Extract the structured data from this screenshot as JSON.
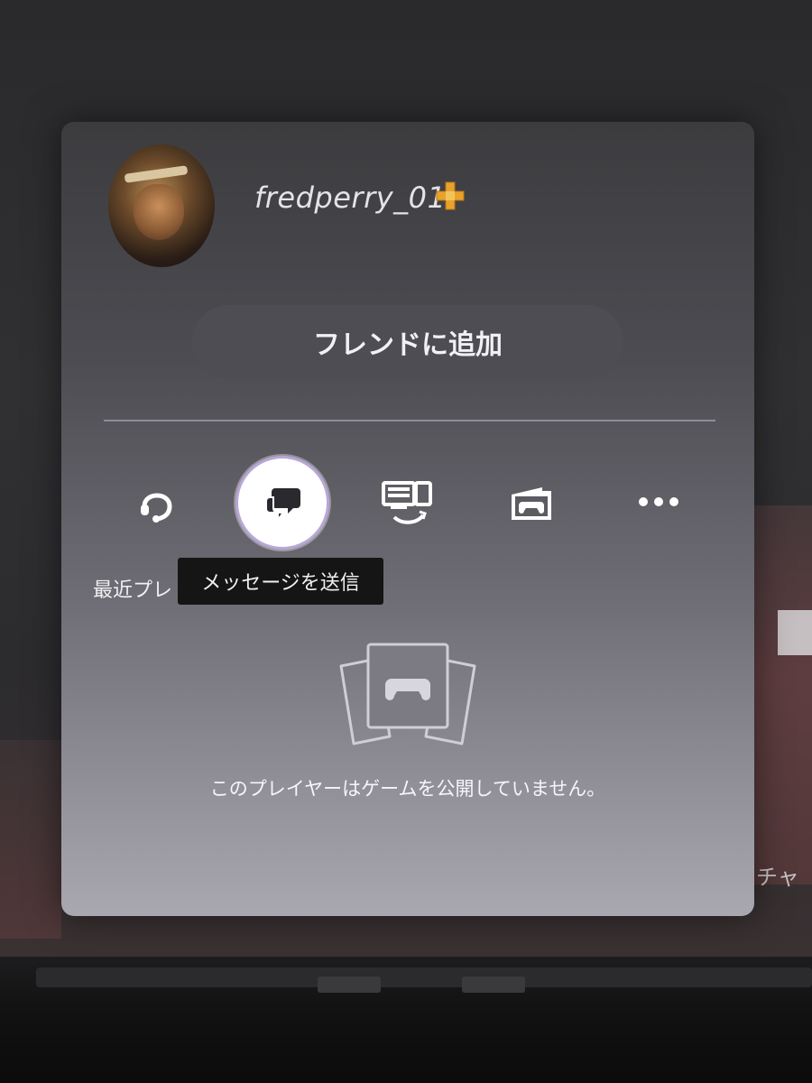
{
  "profile": {
    "username": "fredperry_01",
    "plus_badge_icon": "playstation-plus-icon",
    "plus_color": "#e8a22b"
  },
  "actions": {
    "add_friend_label": "フレンドに追加",
    "icons": [
      "headset-icon",
      "message-icon",
      "share-screen-icon",
      "game-card-icon",
      "more-icon"
    ]
  },
  "tooltip": {
    "text": "メッセージを送信"
  },
  "recent_label": "最近プレ",
  "games": {
    "empty_text": "このプレイヤーはゲームを公開していません。",
    "empty_icon": "game-library-icon"
  },
  "background": {
    "partial_text": "チャ"
  },
  "colors": {
    "accent_ring": "#b9a6d8",
    "tooltip_bg": "#151516"
  }
}
